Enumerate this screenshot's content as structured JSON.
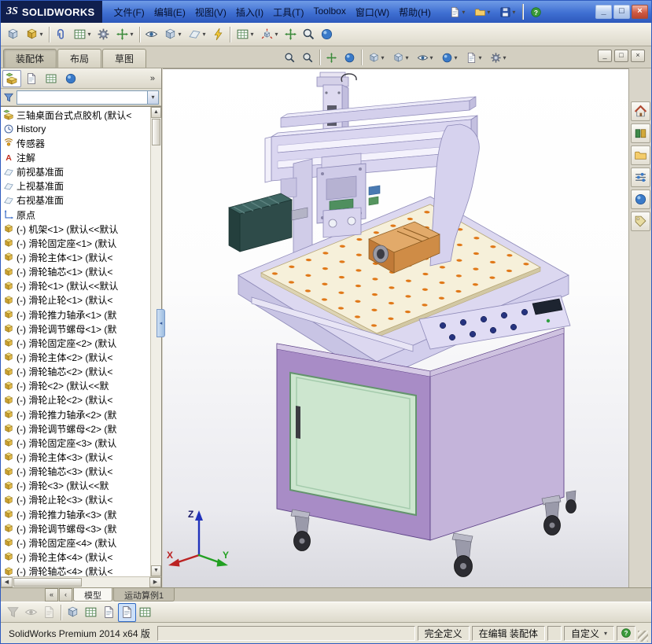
{
  "titlebar": {
    "logo_mark": "ЗS",
    "logo_text": "SOLIDWORKS",
    "menus": [
      {
        "name": "menu-file",
        "label": "文件(F)"
      },
      {
        "name": "menu-edit",
        "label": "编辑(E)"
      },
      {
        "name": "menu-view",
        "label": "视图(V)"
      },
      {
        "name": "menu-insert",
        "label": "插入(I)"
      },
      {
        "name": "menu-tools",
        "label": "工具(T)"
      },
      {
        "name": "menu-toolbox",
        "label": "Toolbox"
      },
      {
        "name": "menu-window",
        "label": "窗口(W)"
      },
      {
        "name": "menu-help",
        "label": "帮助(H)"
      }
    ],
    "quick_icons": [
      {
        "name": "new-document-icon",
        "sym": "#sym-page",
        "flags": "has-caret"
      },
      {
        "name": "open-icon",
        "sym": "#sym-folder",
        "flags": "has-caret"
      },
      {
        "name": "save-icon",
        "sym": "#sym-disk",
        "flags": "has-caret"
      },
      {
        "name": "quickbar-separator",
        "flags": "is-sep",
        "inter": "false"
      },
      {
        "name": "help-icon",
        "sym": "#sym-help",
        "flags": ""
      }
    ],
    "window_buttons": [
      {
        "name": "minimize-button",
        "glyph": "_",
        "kind": "min"
      },
      {
        "name": "maximize-button",
        "glyph": "□",
        "kind": "max"
      },
      {
        "name": "close-button",
        "glyph": "×",
        "kind": "close"
      }
    ]
  },
  "toolbar": {
    "items": [
      {
        "name": "edit-component-icon",
        "sym": "#sym-cube"
      },
      {
        "name": "insert-components-icon",
        "sym": "#sym-part",
        "flags": "has-caret"
      },
      {
        "name": "toolbar-separator",
        "flags": "is-sep",
        "inter": "false"
      },
      {
        "name": "mate-icon",
        "sym": "#sym-clip"
      },
      {
        "name": "linear-component-pattern-icon",
        "sym": "#sym-table",
        "flags": "has-caret"
      },
      {
        "name": "smart-fasteners-icon",
        "sym": "#sym-gear"
      },
      {
        "name": "move-component-icon",
        "sym": "#sym-arrows",
        "flags": "has-caret"
      },
      {
        "name": "toolbar-separator",
        "flags": "is-sep",
        "inter": "false"
      },
      {
        "name": "show-hidden-components-icon",
        "sym": "#sym-eye"
      },
      {
        "name": "assembly-features-icon",
        "sym": "#sym-cube",
        "flags": "has-caret"
      },
      {
        "name": "reference-geometry-icon",
        "sym": "#sym-plane",
        "flags": "has-caret"
      },
      {
        "name": "new-motion-study-icon",
        "sym": "#sym-lightning"
      },
      {
        "name": "toolbar-separator",
        "flags": "is-sep",
        "inter": "false"
      },
      {
        "name": "bill-of-materials-icon",
        "sym": "#sym-table",
        "flags": "has-caret"
      },
      {
        "name": "exploded-view-icon",
        "sym": "#sym-explode",
        "flags": "has-caret"
      },
      {
        "name": "instant3d-icon",
        "sym": "#sym-arrows"
      },
      {
        "name": "take-snapshot-icon",
        "sym": "#sym-magnifier"
      },
      {
        "name": "isolate-icon",
        "sym": "#sym-sphere"
      }
    ]
  },
  "command_tabs": {
    "items": [
      {
        "name": "tab-assembly",
        "label": "装配体",
        "flags": "active"
      },
      {
        "name": "tab-layout",
        "label": "布局",
        "flags": ""
      },
      {
        "name": "tab-sketch",
        "label": "草图",
        "flags": ""
      }
    ]
  },
  "hud": {
    "items": [
      {
        "name": "zoom-to-fit-icon",
        "sym": "#sym-magnifier"
      },
      {
        "name": "zoom-to-area-icon",
        "sym": "#sym-magnifier"
      },
      {
        "name": "hud-separator",
        "flags": "is-sep",
        "inter": "false"
      },
      {
        "name": "previous-view-icon",
        "sym": "#sym-arrows"
      },
      {
        "name": "section-view-icon",
        "sym": "#sym-sphere"
      },
      {
        "name": "hud-separator",
        "flags": "is-sep",
        "inter": "false"
      },
      {
        "name": "view-orientation-icon",
        "sym": "#sym-cube",
        "flags": "has-caret"
      },
      {
        "name": "display-style-icon",
        "sym": "#sym-cube",
        "flags": "has-caret"
      },
      {
        "name": "hide-show-items-icon",
        "sym": "#sym-eye",
        "flags": "has-caret"
      },
      {
        "name": "edit-appearance-icon",
        "sym": "#sym-sphere",
        "flags": "has-caret"
      },
      {
        "name": "apply-scene-icon",
        "sym": "#sym-page",
        "flags": "has-caret"
      },
      {
        "name": "view-settings-icon",
        "sym": "#sym-gear",
        "flags": "has-caret"
      }
    ]
  },
  "document_window_buttons": [
    {
      "name": "doc-minimize-button",
      "glyph": "_"
    },
    {
      "name": "doc-restore-button",
      "glyph": "□"
    },
    {
      "name": "doc-close-button",
      "glyph": "×"
    }
  ],
  "feature_panel": {
    "tabs": [
      {
        "name": "featuremanager-tab",
        "sym": "#sym-assembly",
        "flags": "active"
      },
      {
        "name": "propertymanager-tab",
        "sym": "#sym-page",
        "flags": ""
      },
      {
        "name": "configurationmanager-tab",
        "sym": "#sym-table",
        "flags": ""
      },
      {
        "name": "displaymanager-tab",
        "sym": "#sym-sphere",
        "flags": ""
      }
    ],
    "overflow_label": "»",
    "filter": {
      "value": ""
    },
    "tree": {
      "items": [
        {
          "sym": "#sym-assembly",
          "label": "三轴桌面台式点胶机 (默认<",
          "flags": "root"
        },
        {
          "sym": "#sym-history",
          "label": "History"
        },
        {
          "sym": "#sym-sensor",
          "label": "传感器"
        },
        {
          "sym": "#sym-annotation",
          "label": "注解"
        },
        {
          "sym": "#sym-plane",
          "label": "前视基准面"
        },
        {
          "sym": "#sym-plane",
          "label": "上视基准面"
        },
        {
          "sym": "#sym-plane",
          "label": "右视基准面"
        },
        {
          "sym": "#sym-origin",
          "label": "原点"
        },
        {
          "sym": "#sym-part",
          "label": "(-) 机架<1> (默认<<默认"
        },
        {
          "sym": "#sym-part",
          "label": "(-) 滑轮固定座<1> (默认"
        },
        {
          "sym": "#sym-part",
          "label": "(-) 滑轮主体<1> (默认<"
        },
        {
          "sym": "#sym-part",
          "label": "(-) 滑轮轴芯<1> (默认<"
        },
        {
          "sym": "#sym-part",
          "label": "(-) 滑轮<1> (默认<<默认"
        },
        {
          "sym": "#sym-part",
          "label": "(-) 滑轮止轮<1> (默认<"
        },
        {
          "sym": "#sym-part",
          "label": "(-) 滑轮推力轴承<1> (默"
        },
        {
          "sym": "#sym-part",
          "label": "(-) 滑轮调节螺母<1> (默"
        },
        {
          "sym": "#sym-part",
          "label": "(-) 滑轮固定座<2> (默认"
        },
        {
          "sym": "#sym-part",
          "label": "(-) 滑轮主体<2> (默认<"
        },
        {
          "sym": "#sym-part",
          "label": "(-) 滑轮轴芯<2> (默认<"
        },
        {
          "sym": "#sym-part",
          "label": "(-) 滑轮<2> (默认<<默"
        },
        {
          "sym": "#sym-part",
          "label": "(-) 滑轮止轮<2> (默认<"
        },
        {
          "sym": "#sym-part",
          "label": "(-) 滑轮推力轴承<2> (默"
        },
        {
          "sym": "#sym-part",
          "label": "(-) 滑轮调节螺母<2> (默"
        },
        {
          "sym": "#sym-part",
          "label": "(-) 滑轮固定座<3> (默认"
        },
        {
          "sym": "#sym-part",
          "label": "(-) 滑轮主体<3> (默认<"
        },
        {
          "sym": "#sym-part",
          "label": "(-) 滑轮轴芯<3> (默认<"
        },
        {
          "sym": "#sym-part",
          "label": "(-) 滑轮<3> (默认<<默"
        },
        {
          "sym": "#sym-part",
          "label": "(-) 滑轮止轮<3> (默认<"
        },
        {
          "sym": "#sym-part",
          "label": "(-) 滑轮推力轴承<3> (默"
        },
        {
          "sym": "#sym-part",
          "label": "(-) 滑轮调节螺母<3> (默"
        },
        {
          "sym": "#sym-part",
          "label": "(-) 滑轮固定座<4> (默认"
        },
        {
          "sym": "#sym-part",
          "label": "(-) 滑轮主体<4> (默认<"
        },
        {
          "sym": "#sym-part",
          "label": "(-) 滑轮轴芯<4> (默认<"
        }
      ]
    }
  },
  "viewport": {
    "triad": {
      "x_label": "X",
      "y_label": "Y",
      "z_label": "Z"
    }
  },
  "model_tabs": {
    "nav": [
      {
        "name": "tab-scroll-start-button",
        "glyph": "«"
      },
      {
        "name": "tab-scroll-left-button",
        "glyph": "‹"
      }
    ],
    "items": [
      {
        "name": "tab-model",
        "label": "模型",
        "flags": "active"
      },
      {
        "name": "tab-motion-study-1",
        "label": "运动算例1",
        "flags": ""
      }
    ]
  },
  "bottom_toolbar": {
    "items": [
      {
        "name": "tree-filter-icon",
        "sym": "#sym-funnel",
        "flags": "disabled",
        "inter": "false"
      },
      {
        "name": "hidden-components-icon",
        "sym": "#sym-eye",
        "flags": "disabled",
        "inter": "false"
      },
      {
        "name": "document-preview-icon",
        "sym": "#sym-page",
        "flags": "disabled",
        "inter": "false"
      },
      {
        "name": "bottombar-separator",
        "flags": "is-sep",
        "inter": "false"
      },
      {
        "name": "assembly-visualization-icon",
        "sym": "#sym-cube"
      },
      {
        "name": "performance-evaluation-icon",
        "sym": "#sym-table"
      },
      {
        "name": "sheet-format-icon",
        "sym": "#sym-page"
      },
      {
        "name": "selected-display-mode-icon",
        "sym": "#sym-page",
        "flags": "active"
      },
      {
        "name": "grid-snap-icon",
        "sym": "#sym-table"
      }
    ]
  },
  "status_bar": {
    "left_text": "SolidWorks Premium 2014 x64 版",
    "cells": [
      {
        "name": "status-definition",
        "label": "完全定义",
        "flags": "",
        "inter": "false"
      },
      {
        "name": "status-editing-state",
        "label": "在编辑 装配体",
        "flags": "",
        "inter": "false"
      },
      {
        "name": "status-spacer",
        "label": "",
        "flags": "small",
        "inter": "false"
      },
      {
        "name": "status-customize",
        "label": "自定义",
        "flags": "has-caret"
      }
    ]
  },
  "task_pane": {
    "items": [
      {
        "name": "solidworks-resources-tab",
        "sym": "#sym-house"
      },
      {
        "name": "design-library-tab",
        "sym": "#sym-book"
      },
      {
        "name": "file-explorer-tab",
        "sym": "#sym-folder"
      },
      {
        "name": "view-palette-tab",
        "sym": "#sym-sliders"
      },
      {
        "name": "appearances-tab",
        "sym": "#sym-sphere"
      },
      {
        "name": "custom-properties-tab",
        "sym": "#sym-tag"
      }
    ]
  },
  "scrollbars": {
    "up": "▲",
    "down": "▼",
    "left": "◀",
    "right": "▶"
  },
  "splitter_glyph": "◂",
  "colors": {
    "accent": "#316ac5",
    "cabinet": "#a88cc6",
    "door": "#cde6cf",
    "table_dot": "#e07818"
  }
}
